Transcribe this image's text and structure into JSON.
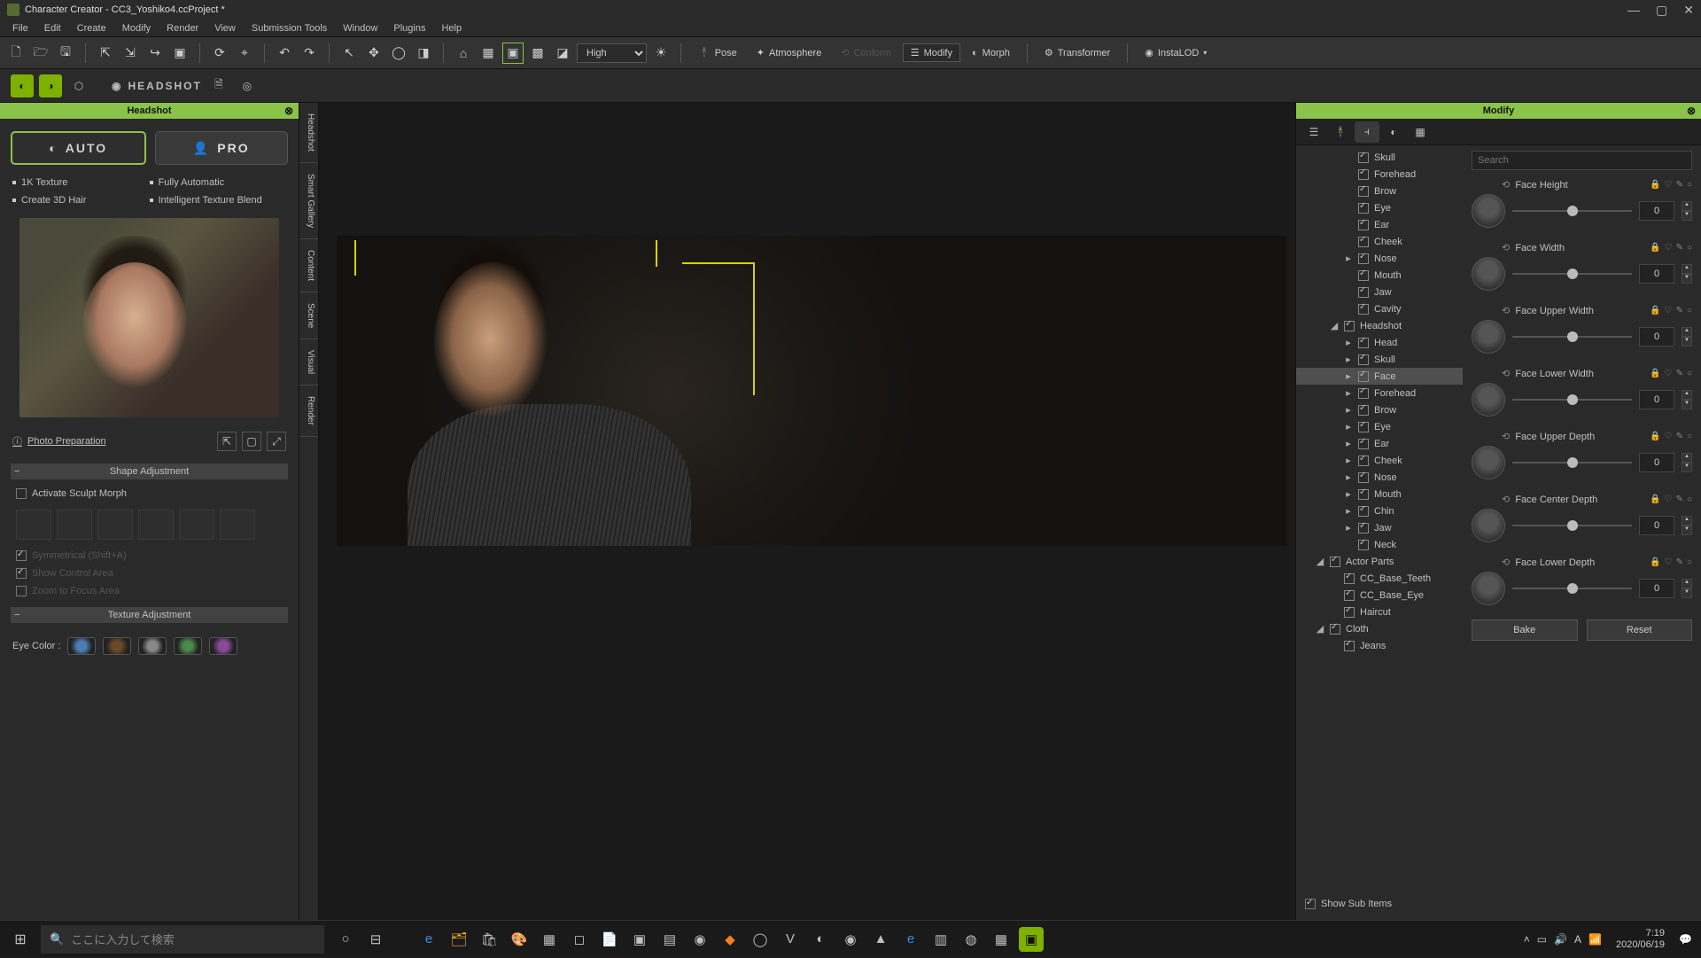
{
  "window": {
    "title": "Character Creator - CC3_Yoshiko4.ccProject *"
  },
  "menu": [
    "File",
    "Edit",
    "Create",
    "Modify",
    "Render",
    "View",
    "Submission Tools",
    "Window",
    "Plugins",
    "Help"
  ],
  "toolbar": {
    "quality": "High",
    "pose": "Pose",
    "atmosphere": "Atmosphere",
    "conform": "Conform",
    "modify": "Modify",
    "morph": "Morph",
    "transformer": "Transformer",
    "instalod": "InstaLOD"
  },
  "headshot_logo": "HEADSHOT",
  "side_tabs": [
    "Headshot",
    "Smart Gallery",
    "Content",
    "Scene",
    "Visual",
    "Render"
  ],
  "headshot": {
    "title": "Headshot",
    "auto": "AUTO",
    "pro": "PRO",
    "features": {
      "f1": "1K Texture",
      "f2": "Fully Automatic",
      "f3": "Create 3D Hair",
      "f4": "Intelligent Texture Blend"
    },
    "photo_prep": "Photo Preparation",
    "shape_adj": "Shape Adjustment",
    "activate_sculpt": "Activate Sculpt Morph",
    "symmetrical": "Symmetrical (Shift+A)",
    "show_control": "Show Control Area",
    "zoom_focus": "Zoom to Focus Area",
    "texture_adj": "Texture Adjustment",
    "eye_color": "Eye Color :"
  },
  "modify": {
    "title": "Modify",
    "search_ph": "Search",
    "tree": [
      {
        "ind": 3,
        "exp": "",
        "chk": true,
        "label": "Skull"
      },
      {
        "ind": 3,
        "exp": "",
        "chk": true,
        "label": "Forehead"
      },
      {
        "ind": 3,
        "exp": "",
        "chk": true,
        "label": "Brow"
      },
      {
        "ind": 3,
        "exp": "",
        "chk": true,
        "label": "Eye"
      },
      {
        "ind": 3,
        "exp": "",
        "chk": true,
        "label": "Ear"
      },
      {
        "ind": 3,
        "exp": "",
        "chk": true,
        "label": "Cheek"
      },
      {
        "ind": 3,
        "exp": "▸",
        "chk": true,
        "label": "Nose"
      },
      {
        "ind": 3,
        "exp": "",
        "chk": true,
        "label": "Mouth"
      },
      {
        "ind": 3,
        "exp": "",
        "chk": true,
        "label": "Jaw"
      },
      {
        "ind": 3,
        "exp": "",
        "chk": true,
        "label": "Cavity"
      },
      {
        "ind": 2,
        "exp": "◢",
        "chk": true,
        "label": "Headshot"
      },
      {
        "ind": 3,
        "exp": "▸",
        "chk": true,
        "label": "Head"
      },
      {
        "ind": 3,
        "exp": "▸",
        "chk": true,
        "label": "Skull"
      },
      {
        "ind": 3,
        "exp": "▸",
        "chk": true,
        "label": "Face",
        "sel": true
      },
      {
        "ind": 3,
        "exp": "▸",
        "chk": true,
        "label": "Forehead"
      },
      {
        "ind": 3,
        "exp": "▸",
        "chk": true,
        "label": "Brow"
      },
      {
        "ind": 3,
        "exp": "▸",
        "chk": true,
        "label": "Eye"
      },
      {
        "ind": 3,
        "exp": "▸",
        "chk": true,
        "label": "Ear"
      },
      {
        "ind": 3,
        "exp": "▸",
        "chk": true,
        "label": "Cheek"
      },
      {
        "ind": 3,
        "exp": "▸",
        "chk": true,
        "label": "Nose"
      },
      {
        "ind": 3,
        "exp": "▸",
        "chk": true,
        "label": "Mouth"
      },
      {
        "ind": 3,
        "exp": "▸",
        "chk": true,
        "label": "Chin"
      },
      {
        "ind": 3,
        "exp": "▸",
        "chk": true,
        "label": "Jaw"
      },
      {
        "ind": 3,
        "exp": "",
        "chk": true,
        "label": "Neck"
      },
      {
        "ind": 1,
        "exp": "◢",
        "chk": true,
        "label": "Actor Parts"
      },
      {
        "ind": 2,
        "exp": "",
        "chk": true,
        "label": "CC_Base_Teeth"
      },
      {
        "ind": 2,
        "exp": "",
        "chk": true,
        "label": "CC_Base_Eye"
      },
      {
        "ind": 2,
        "exp": "",
        "chk": true,
        "label": "Haircut"
      },
      {
        "ind": 1,
        "exp": "◢",
        "chk": true,
        "label": "Cloth"
      },
      {
        "ind": 2,
        "exp": "",
        "chk": true,
        "label": "Jeans"
      }
    ],
    "sliders": [
      {
        "label": "Face Height",
        "val": "0"
      },
      {
        "label": "Face Width",
        "val": "0"
      },
      {
        "label": "Face Upper Width",
        "val": "0"
      },
      {
        "label": "Face Lower Width",
        "val": "0"
      },
      {
        "label": "Face Upper Depth",
        "val": "0"
      },
      {
        "label": "Face Center Depth",
        "val": "0"
      },
      {
        "label": "Face Lower Depth",
        "val": "0"
      }
    ],
    "show_sub": "Show Sub Items",
    "bake": "Bake",
    "reset": "Reset"
  },
  "taskbar": {
    "search": "ここに入力して検索",
    "time": "7:19",
    "date": "2020/06/19"
  }
}
